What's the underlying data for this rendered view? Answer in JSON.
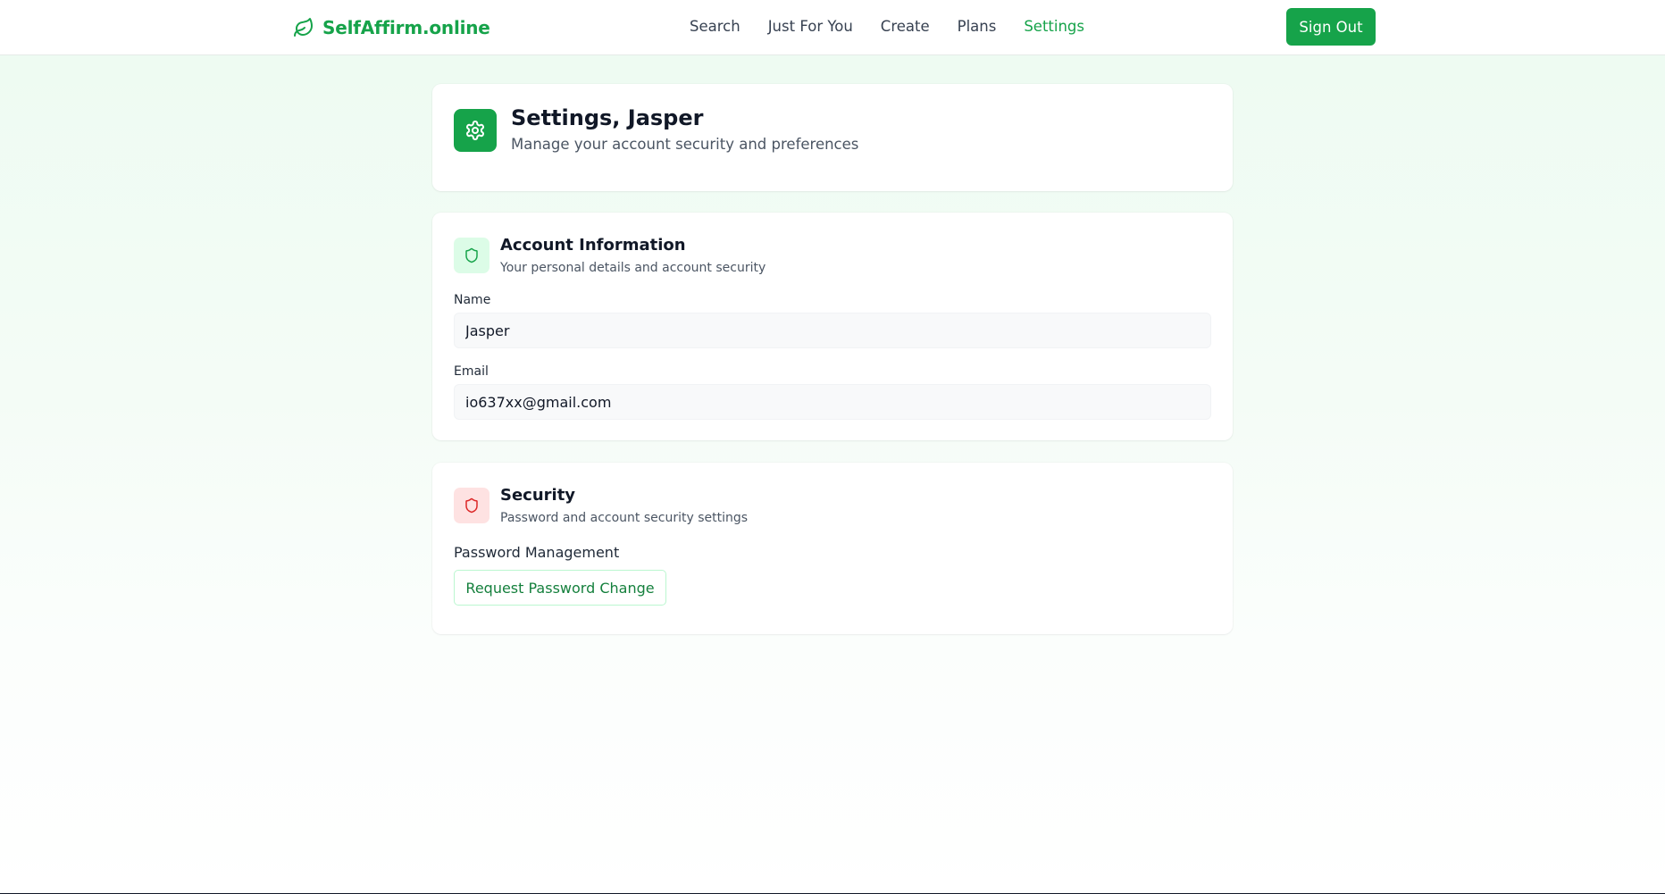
{
  "nav": {
    "brand": "SelfAffirm.online",
    "links": [
      "Search",
      "Just For You",
      "Create",
      "Plans",
      "Settings"
    ],
    "sign_out": "Sign Out"
  },
  "header": {
    "title": "Settings, Jasper",
    "subtitle": "Manage your account security and preferences"
  },
  "account": {
    "title": "Account Information",
    "subtitle": "Your personal details and account security",
    "name_label": "Name",
    "name_value": "Jasper",
    "email_label": "Email",
    "email_value": "io637xx@gmail.com"
  },
  "security": {
    "title": "Security",
    "subtitle": "Password and account security settings",
    "password_label": "Password Management",
    "password_button": "Request Password Change"
  },
  "colors": {
    "brand": "#16a34a",
    "security_accent": "#dc2626"
  },
  "icons": {
    "brand": "leaf-icon",
    "header": "gear-icon",
    "account": "shield-icon",
    "security": "shield-icon"
  }
}
